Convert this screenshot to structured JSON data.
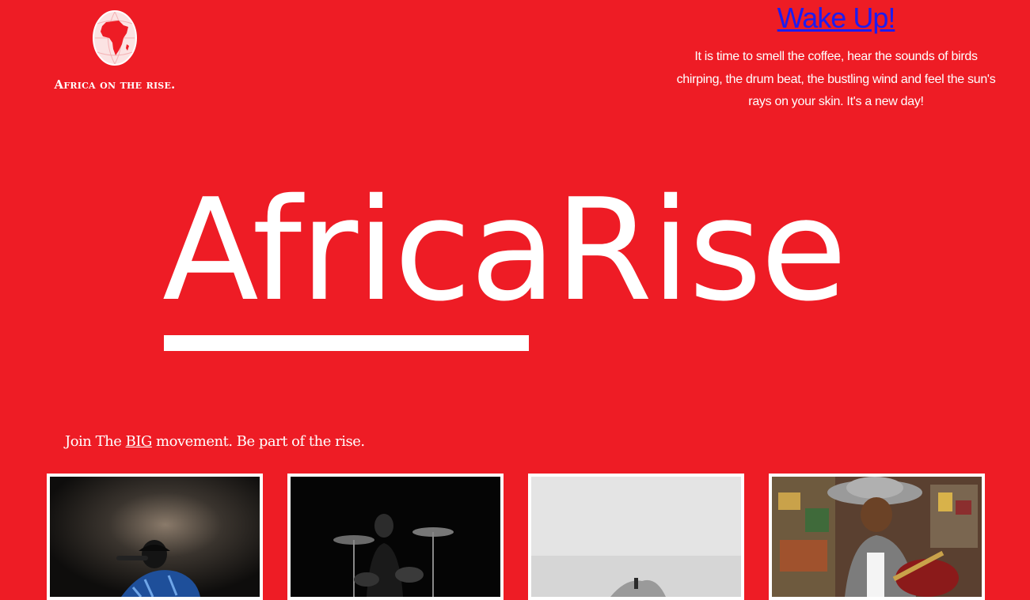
{
  "logo": {
    "tagline": "Africa on the rise."
  },
  "wake": {
    "title": "Wake Up!",
    "text": "It is time to smell the coffee, hear the sounds of birds chirping, the drum beat, the bustling wind and feel the sun's rays on your skin. It's a new day!"
  },
  "hero": {
    "part1": "Africa",
    "part2": "Rise"
  },
  "join": {
    "before": "Join The ",
    "big": "BIG",
    "after": " movement. Be part of the rise."
  },
  "colors": {
    "background": "#ee1c25",
    "text": "#ffffff",
    "link": "#1c1cf0"
  }
}
